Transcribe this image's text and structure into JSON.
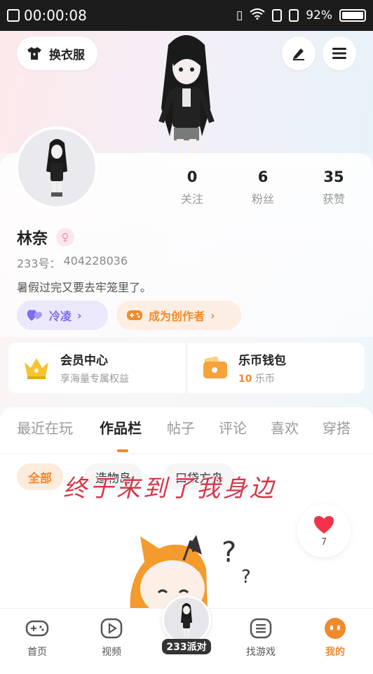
{
  "status_bar": {
    "time": "00:00:08",
    "battery": "92%"
  },
  "header": {
    "wardrobe_label": "换衣服",
    "edit_icon": "pencil-icon",
    "menu_icon": "hamburger-menu-icon"
  },
  "profile": {
    "stats": [
      {
        "value": "0",
        "label": "关注"
      },
      {
        "value": "6",
        "label": "粉丝"
      },
      {
        "value": "35",
        "label": "获赞"
      }
    ],
    "name": "林奈",
    "gender_symbol": "♀",
    "id_label": "233号：",
    "id_value": "404228036",
    "bio": "暑假过完又要去牢笼里了。",
    "friends_label": "冷凌",
    "creator_label": "成为创作者"
  },
  "cards": {
    "vip_title": "会员中心",
    "vip_sub": "享海量专属权益",
    "wallet_title": "乐币钱包",
    "wallet_amount": "10",
    "wallet_unit": "乐币"
  },
  "tabs": [
    "最近在玩",
    "作品栏",
    "帖子",
    "评论",
    "喜欢",
    "穿搭"
  ],
  "active_tab": "作品栏",
  "filters": [
    "全部",
    "造物岛",
    "口袋方舟"
  ],
  "overlay_caption": "终于来到了我身边",
  "like_count": "7",
  "bottom_nav": {
    "items": [
      {
        "label": "首页",
        "icon": "gamepad-icon"
      },
      {
        "label": "视频",
        "icon": "play-icon"
      },
      {
        "label": "找游戏",
        "icon": "list-icon"
      },
      {
        "label": "我的",
        "icon": "face-icon"
      }
    ],
    "center_label": "233派对"
  },
  "colors": {
    "accent": "#f08a2c",
    "friends": "#7b6cf0",
    "heart": "#f0334a"
  }
}
